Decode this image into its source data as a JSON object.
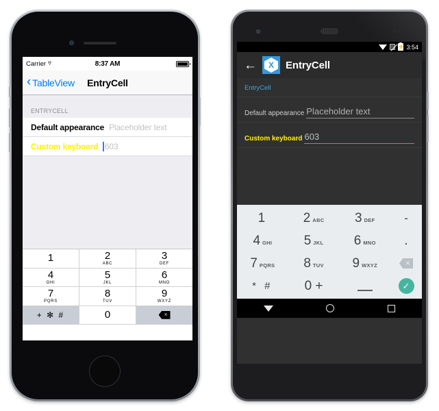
{
  "ios": {
    "status": {
      "carrier": "Carrier",
      "wifi_icon": "wifi-icon",
      "time": "8:37 AM",
      "battery_icon": "battery-full-icon"
    },
    "navbar": {
      "back_label": "TableView",
      "back_icon": "chevron-left-icon",
      "title": "EntryCell"
    },
    "table": {
      "section_header": "ENTRYCELL",
      "rows": [
        {
          "label": "Default appearance",
          "value": "",
          "placeholder": "Placeholder text",
          "focused": false
        },
        {
          "label": "Custom keyboard",
          "value": "",
          "placeholder": "603",
          "focused": true
        }
      ]
    },
    "keypad": [
      [
        {
          "num": "1",
          "sub": "",
          "style": "white"
        },
        {
          "num": "2",
          "sub": "ABC",
          "style": "white"
        },
        {
          "num": "3",
          "sub": "DEF",
          "style": "white"
        }
      ],
      [
        {
          "num": "4",
          "sub": "GHI",
          "style": "white"
        },
        {
          "num": "5",
          "sub": "JKL",
          "style": "white"
        },
        {
          "num": "6",
          "sub": "MNO",
          "style": "white"
        }
      ],
      [
        {
          "num": "7",
          "sub": "PQRS",
          "style": "white"
        },
        {
          "num": "8",
          "sub": "TUV",
          "style": "white"
        },
        {
          "num": "9",
          "sub": "WXYZ",
          "style": "white"
        }
      ]
    ],
    "keypad_bottom": {
      "symbols": "+ ✻ #",
      "zero": "0",
      "delete_icon": "backspace-icon"
    }
  },
  "android": {
    "status": {
      "wifi_icon": "wifi-icon",
      "signal_icon": "no-signal-icon",
      "battery_icon": "battery-charging-icon",
      "time": "3:54"
    },
    "appbar": {
      "back_icon": "arrow-left-icon",
      "logo_icon": "xamarin-logo-icon",
      "logo_letter": "X",
      "title": "EntryCell"
    },
    "content": {
      "section_header": "EntryCell",
      "rows": [
        {
          "label": "Default appearance",
          "value": "",
          "placeholder": "Placeholder text",
          "focused": false
        },
        {
          "label": "Custom keyboard",
          "value": "",
          "placeholder": "603",
          "focused": true
        }
      ]
    },
    "keypad": [
      [
        {
          "num": "1",
          "sub": ""
        },
        {
          "num": "2",
          "sub": "ABC"
        },
        {
          "num": "3",
          "sub": "DEF"
        }
      ],
      [
        {
          "num": "4",
          "sub": "GHI"
        },
        {
          "num": "5",
          "sub": "JKL"
        },
        {
          "num": "6",
          "sub": "MNO"
        }
      ],
      [
        {
          "num": "7",
          "sub": "PQRS"
        },
        {
          "num": "8",
          "sub": "TUV"
        },
        {
          "num": "9",
          "sub": "WXYZ"
        }
      ],
      [
        {
          "num": "* #",
          "sub": ""
        },
        {
          "num": "0 +",
          "sub": ""
        },
        {
          "num": "_",
          "sub": ""
        }
      ]
    ],
    "keypad_side": {
      "dash": "-",
      "dot": ".",
      "delete_icon": "backspace-icon",
      "ok_icon": "check-icon",
      "ok_glyph": "✓"
    },
    "navbar": {
      "back_icon": "nav-back-triangle-icon",
      "home_icon": "nav-home-circle-icon",
      "recents_icon": "nav-recents-square-icon"
    }
  },
  "colors": {
    "ios_accent": "#007aff",
    "ios_custom_label": "#fff200",
    "android_accent": "#3ea6dd",
    "android_focus_underline": "#34b39c",
    "android_ok": "#46b5a0",
    "xamarin_blue": "#3498db"
  }
}
